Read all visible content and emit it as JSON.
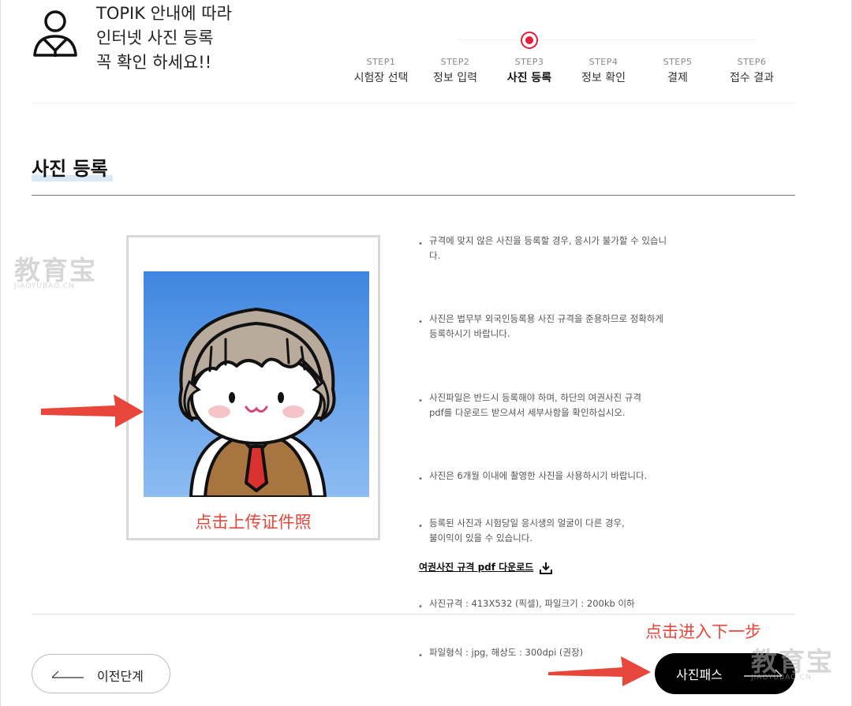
{
  "header": {
    "intro_lines": [
      "TOPIK 안내에 따라",
      "인터넷 사진 등록",
      "꼭 확인 하세요!!"
    ],
    "icon": "user-icon"
  },
  "steps": [
    {
      "num": "STEP1",
      "label": "시험장 선택",
      "active": false
    },
    {
      "num": "STEP2",
      "label": "정보 입력",
      "active": false
    },
    {
      "num": "STEP3",
      "label": "사진 등록",
      "active": true
    },
    {
      "num": "STEP4",
      "label": "정보 확인",
      "active": false
    },
    {
      "num": "STEP5",
      "label": "결제",
      "active": false
    },
    {
      "num": "STEP6",
      "label": "접수 결과",
      "active": false
    }
  ],
  "page": {
    "title": "사진 등록"
  },
  "photo": {
    "caption": "点击上传证件照"
  },
  "notes": [
    {
      "l1": "규격에 맞지 않은 사진을 등록할 경우, 응시가 불가할 수 있습니",
      "l2": "다."
    },
    {
      "l1": "사진은 법무부 외국인등록용 사진 규격을 준용하므로 정확하게",
      "l2": "등록하시기 바랍니다."
    },
    {
      "l1": "사진파일은 반드시 등록해야 하며, 하단의 여권사진 규격",
      "l2": "pdf를 다운로드 받으셔서 세부사항을 확인하십시오."
    },
    {
      "l1": "사진은 6개월 이내에 촬영한 사진을 사용하시기 바랍니다.",
      "l2": ""
    },
    {
      "l1": "등록된 사진과 시험당일 응시생의 얼굴이 다른 경우,",
      "l2": "불이익이 있을 수 있습니다."
    },
    {
      "l1": "사진규격 : 413X532 (픽셀), 파일크기 : 200kb 이하",
      "l2": ""
    },
    {
      "l1": "파일형식 : jpg, 해상도 : 300dpi (권장)",
      "l2": ""
    }
  ],
  "pdf_link": {
    "label": "여권사진 규격 pdf 다운로드",
    "icon": "download-icon"
  },
  "annotations": {
    "next_hint": "点击进入下一步"
  },
  "buttons": {
    "prev": "이전단계",
    "next": "사진패스"
  },
  "watermark": {
    "big": "教育宝",
    "small": "JIAOYUBAO.CN"
  },
  "colors": {
    "accent_red": "#e51e37",
    "annotation_red": "#e8463a",
    "photo_bg": "#5b9be8",
    "button_dark": "#000000"
  }
}
